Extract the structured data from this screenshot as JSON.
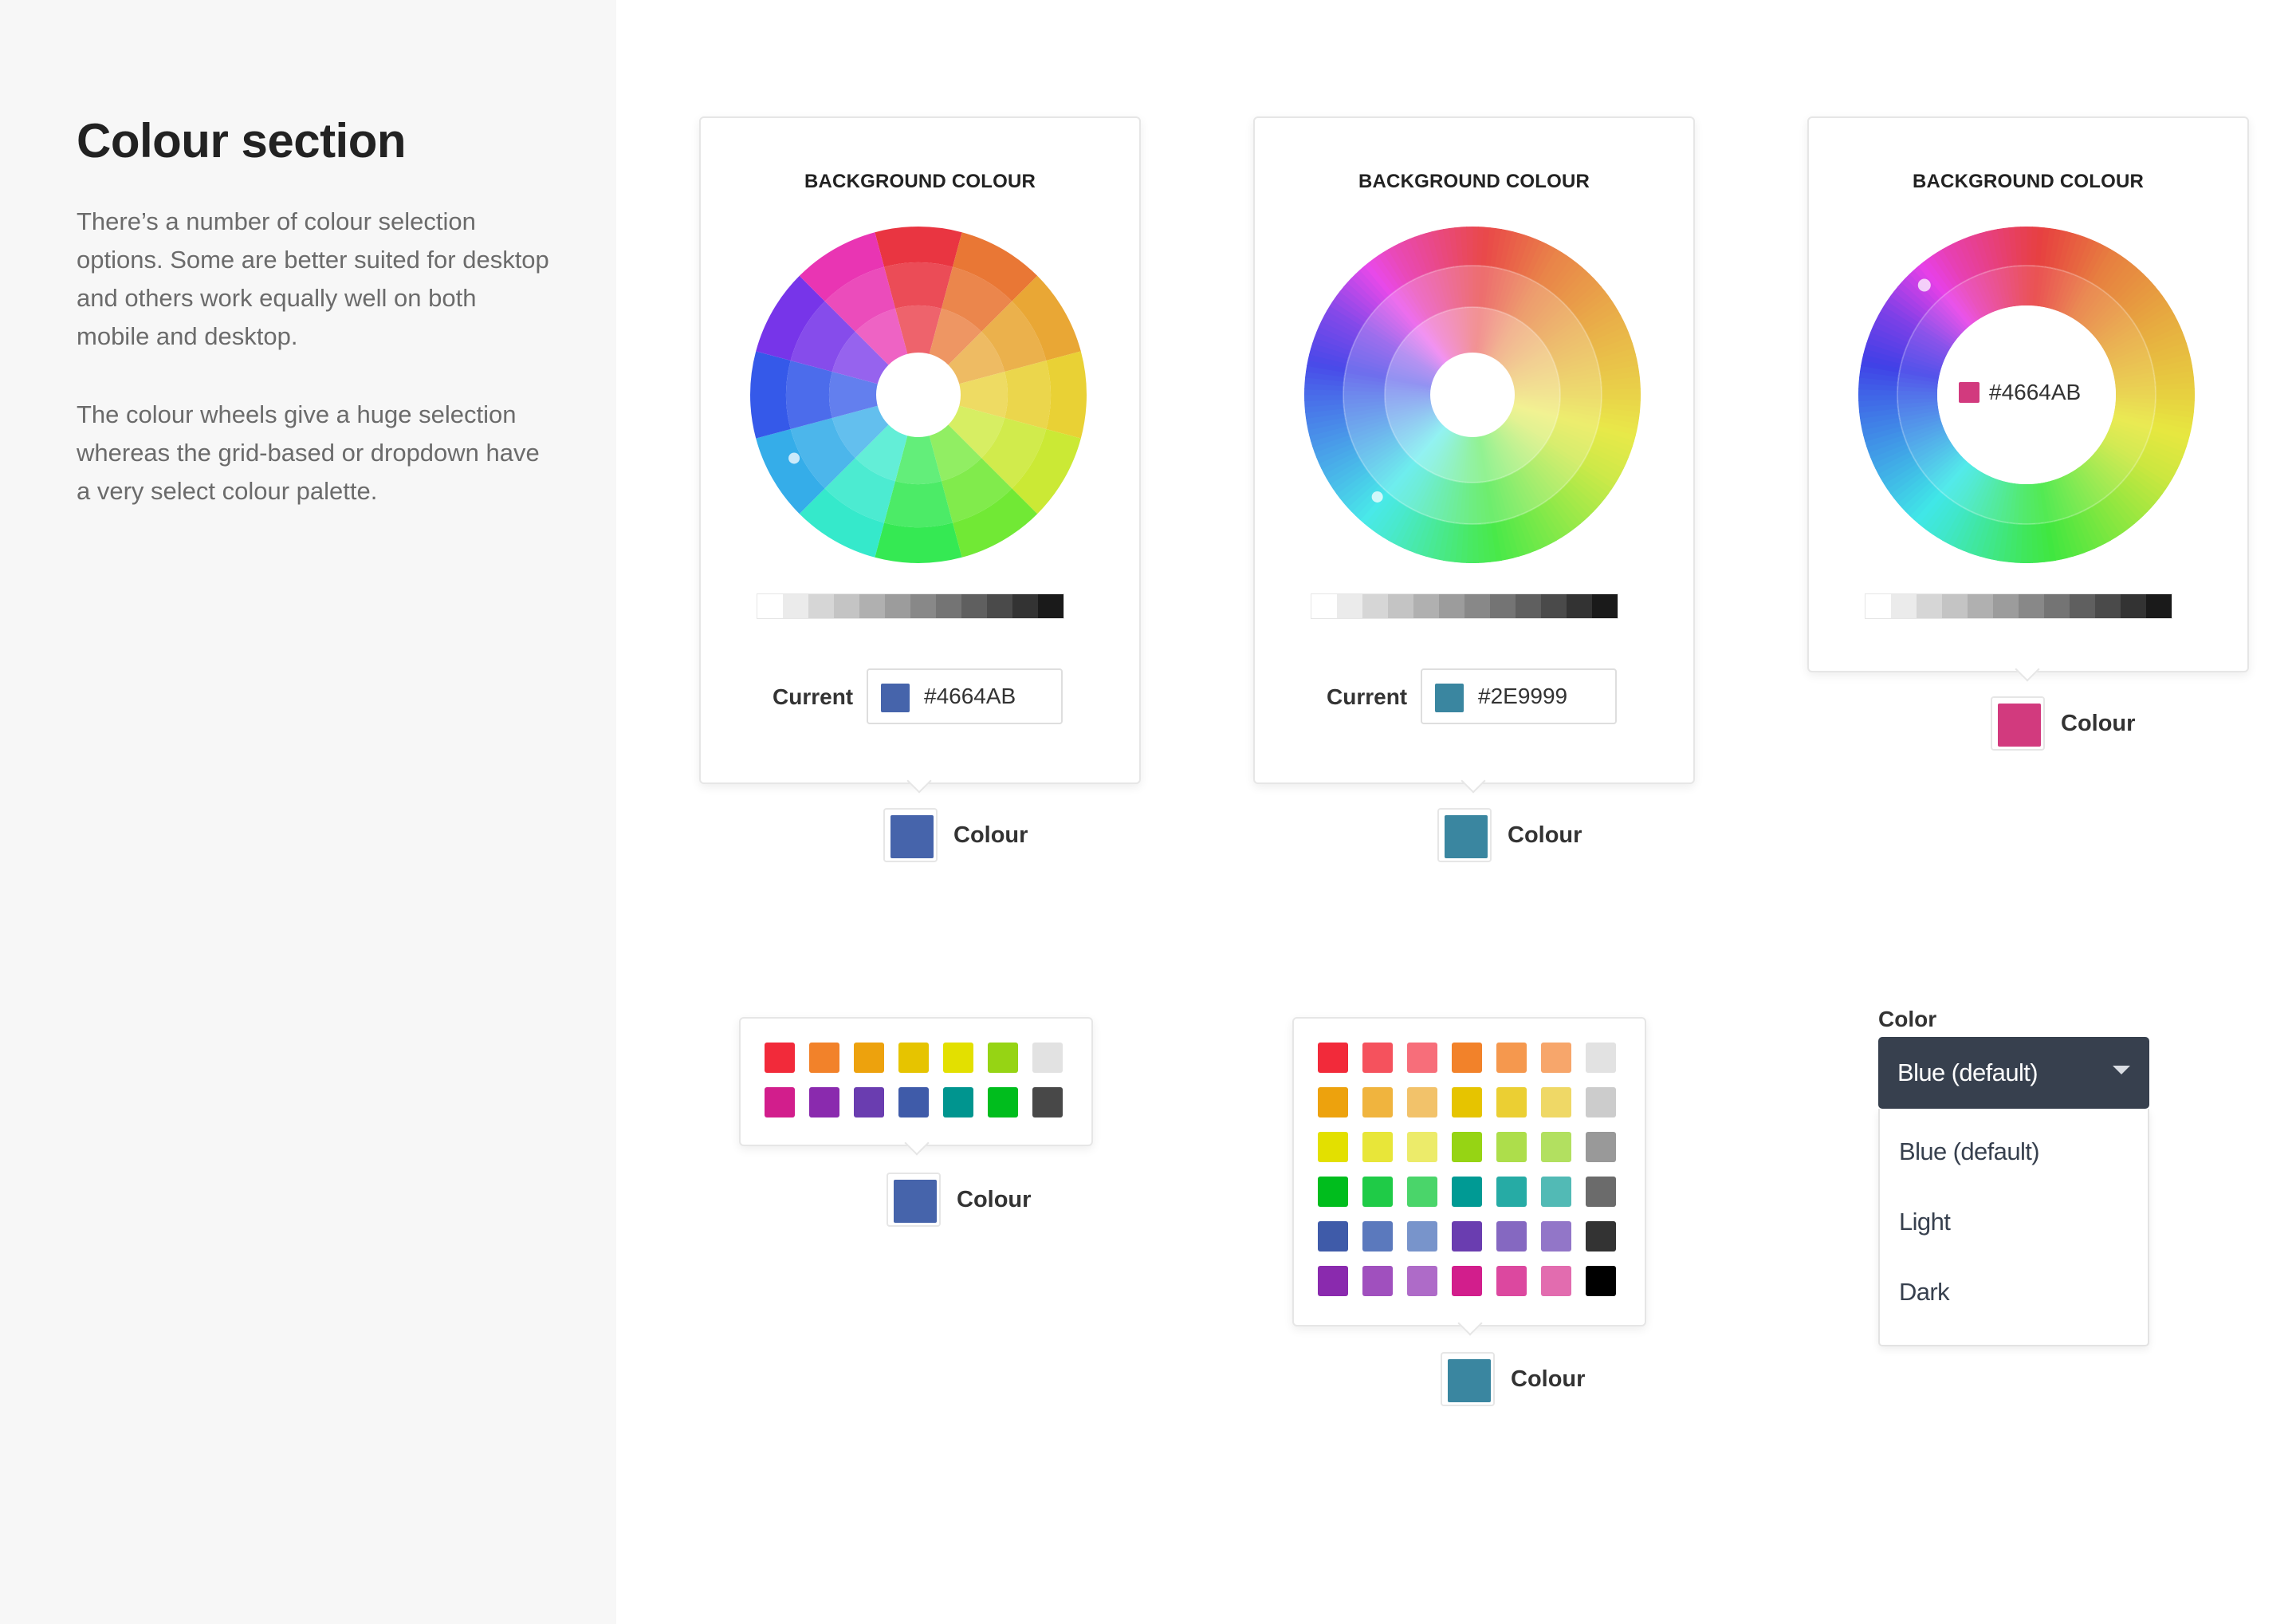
{
  "sidebar": {
    "title": "Colour section",
    "paragraph1": "There’s a number of colour selection options. Some are better suited for desktop and others work equally well on both mobile and desktop.",
    "paragraph2": "The colour wheels give a huge selection whereas the grid-based or dropdown have a very select colour palette."
  },
  "pickers": [
    {
      "title": "BACKGROUND COLOUR",
      "style": "segmented-wheel",
      "current_label": "Current",
      "current_value": "#4664AB",
      "current_color": "#4664AB",
      "trigger_label": "Colour",
      "trigger_color": "#4664AB"
    },
    {
      "title": "BACKGROUND COLOUR",
      "style": "smooth-wheel",
      "current_label": "Current",
      "current_value": "#2E9999",
      "current_color": "#3A86A0",
      "trigger_label": "Colour",
      "trigger_color": "#3A86A0"
    },
    {
      "title": "BACKGROUND COLOUR",
      "style": "ring-wheel",
      "center_value": "#4664AB",
      "center_color": "#D23A7E",
      "trigger_label": "Colour",
      "trigger_color": "#D23A7E"
    }
  ],
  "grayscale": [
    "#ffffff",
    "#ebebeb",
    "#d6d6d6",
    "#c4c4c4",
    "#b0b0b0",
    "#9c9c9c",
    "#888888",
    "#747474",
    "#5f5f5f",
    "#4a4a4a",
    "#333333",
    "#1a1a1a"
  ],
  "small_grid": {
    "trigger_label": "Colour",
    "trigger_color": "#4664AB",
    "rows": [
      [
        "#F22A3A",
        "#F2822A",
        "#EDA20D",
        "#E6C400",
        "#E3E000",
        "#96D414",
        "#E2E2E2"
      ],
      [
        "#D21E8C",
        "#8A2AAE",
        "#6A3DB0",
        "#3F5BA9",
        "#00958F",
        "#00BD1D",
        "#484848"
      ]
    ]
  },
  "large_grid": {
    "trigger_label": "Colour",
    "trigger_color": "#3A86A0",
    "rows": [
      [
        "#F22A3A",
        "#F5525D",
        "#F76E7A",
        "#F2822A",
        "#F5984E",
        "#F7A66B",
        "#E2E2E2"
      ],
      [
        "#EDA20D",
        "#F0B43E",
        "#F2C26A",
        "#E6C400",
        "#EBCF33",
        "#EFD866",
        "#CCCCCC"
      ],
      [
        "#E3E000",
        "#E8E639",
        "#ECEB6A",
        "#96D414",
        "#ADDE4B",
        "#B2E060",
        "#999999"
      ],
      [
        "#00BD1D",
        "#1FCB47",
        "#4AD56A",
        "#009A94",
        "#26ABA5",
        "#52BAB5",
        "#6B6B6B"
      ],
      [
        "#3F5BA9",
        "#5B79BD",
        "#7894CB",
        "#6A3DB0",
        "#8568C1",
        "#9276C8",
        "#333333"
      ],
      [
        "#8A2AAE",
        "#A050BE",
        "#AE6BC8",
        "#D21E8C",
        "#DC489F",
        "#E26CAF",
        "#000000"
      ]
    ]
  },
  "dropdown": {
    "caption": "Color",
    "selected": "Blue (default)",
    "options": [
      "Blue (default)",
      "Light",
      "Dark"
    ]
  }
}
